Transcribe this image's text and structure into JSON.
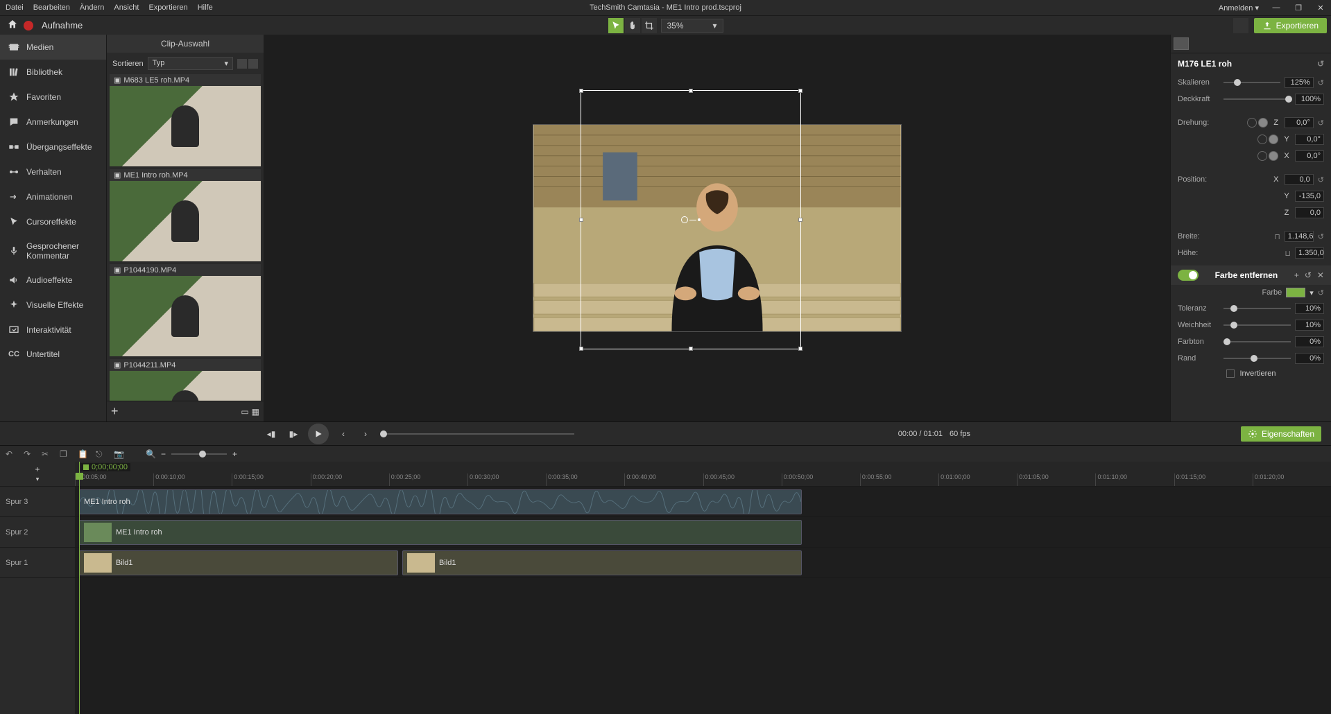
{
  "title": "TechSmith Camtasia - ME1 Intro prod.tscproj",
  "menus": [
    "Datei",
    "Bearbeiten",
    "Ändern",
    "Ansicht",
    "Exportieren",
    "Hilfe"
  ],
  "login": "Anmelden",
  "record_label": "Aufnahme",
  "canvas_zoom": "35%",
  "export_label": "Exportieren",
  "sidebar": [
    {
      "icon": "media",
      "label": "Medien"
    },
    {
      "icon": "library",
      "label": "Bibliothek"
    },
    {
      "icon": "star",
      "label": "Favoriten"
    },
    {
      "icon": "annot",
      "label": "Anmerkungen"
    },
    {
      "icon": "trans",
      "label": "Übergangseffekte"
    },
    {
      "icon": "behav",
      "label": "Verhalten"
    },
    {
      "icon": "anim",
      "label": "Animationen"
    },
    {
      "icon": "cursor",
      "label": "Cursoreffekte"
    },
    {
      "icon": "mic",
      "label": "Gesprochener Kommentar"
    },
    {
      "icon": "audio",
      "label": "Audioeffekte"
    },
    {
      "icon": "vis",
      "label": "Visuelle Effekte"
    },
    {
      "icon": "inter",
      "label": "Interaktivität"
    },
    {
      "icon": "cc",
      "label": "Untertitel"
    }
  ],
  "clip_panel": {
    "title": "Clip-Auswahl",
    "sort_label": "Sortieren",
    "sort_by": "Typ",
    "items": [
      {
        "name": "M683 LE5 roh.MP4"
      },
      {
        "name": "ME1 Intro roh.MP4"
      },
      {
        "name": "P1044190.MP4"
      },
      {
        "name": "P1044211.MP4"
      }
    ]
  },
  "props": {
    "clip_name": "M176 LE1 roh",
    "scale": {
      "label": "Skalieren",
      "value": "125%"
    },
    "opacity": {
      "label": "Deckkraft",
      "value": "100%"
    },
    "rotation": {
      "label": "Drehung:",
      "z": "0,0°",
      "y": "0,0°",
      "x": "0,0°"
    },
    "position": {
      "label": "Position:",
      "x": "0,0",
      "y": "-135,0",
      "z": "0,0"
    },
    "width": {
      "label": "Breite:",
      "value": "1.148,6"
    },
    "height": {
      "label": "Höhe:",
      "value": "1.350,0"
    },
    "fx": {
      "title": "Farbe entfernen",
      "color_label": "Farbe",
      "tolerance": {
        "label": "Toleranz",
        "value": "10%"
      },
      "softness": {
        "label": "Weichheit",
        "value": "10%"
      },
      "hue": {
        "label": "Farbton",
        "value": "0%"
      },
      "edge": {
        "label": "Rand",
        "value": "0%"
      },
      "invert": "Invertieren"
    }
  },
  "playback": {
    "time": "00:00 / 01:01",
    "fps": "60 fps",
    "props_btn": "Eigenschaften"
  },
  "timeline": {
    "playhead": "0;00;00;00",
    "ticks": [
      "0:00:05;00",
      "0:00:10;00",
      "0:00:15;00",
      "0:00:20;00",
      "0:00:25;00",
      "0:00:30;00",
      "0:00:35;00",
      "0:00:40;00",
      "0:00:45;00",
      "0:00:50;00",
      "0:00:55;00",
      "0:01:00;00",
      "0:01:05;00",
      "0:01:10;00",
      "0:01:15;00",
      "0:01:20;00"
    ],
    "tracks": [
      "Spur 3",
      "Spur 2",
      "Spur 1"
    ],
    "clips": {
      "t3": {
        "label": "ME1 Intro roh"
      },
      "t2": {
        "label": "ME1 Intro roh"
      },
      "t1a": {
        "label": "Bild1"
      },
      "t1b": {
        "label": "Bild1"
      }
    }
  }
}
